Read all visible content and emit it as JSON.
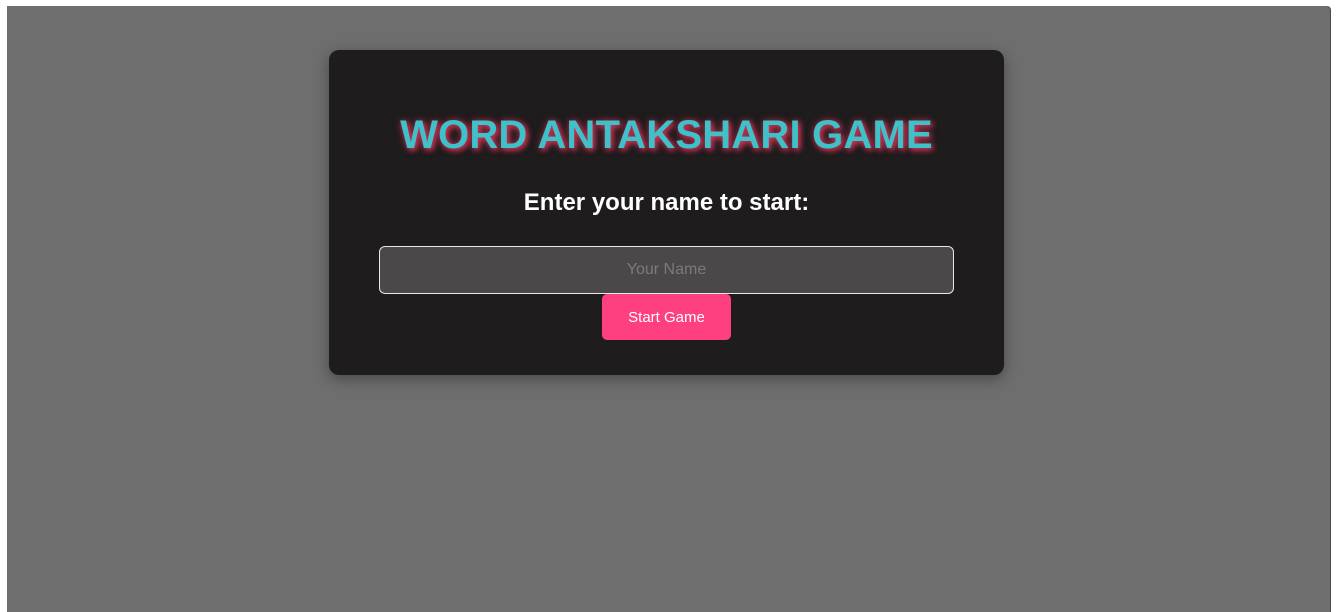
{
  "game": {
    "title": "WORD ANTAKSHARI GAME",
    "prompt": "Enter your name to start:",
    "name_input": {
      "value": "",
      "placeholder": "Your Name"
    },
    "start_button_label": "Start Game"
  },
  "colors": {
    "page_background": "#6e6e6e",
    "card_background": "#1e1c1d",
    "title_color": "#3ec1c9",
    "title_glow": "#e0355a",
    "button_color": "#fe3f80",
    "input_background": "#4a4849"
  }
}
